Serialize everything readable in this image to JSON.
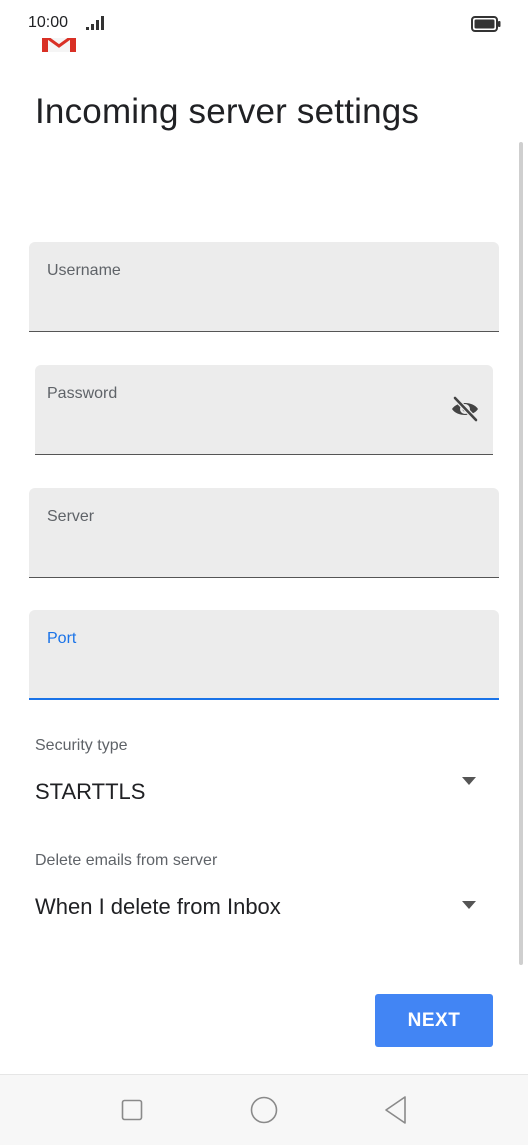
{
  "status_bar": {
    "time": "10:00",
    "signal_icon": "signal-bars-icon",
    "battery_icon": "battery-full-icon"
  },
  "app": {
    "logo_icon": "gmail-logo-icon"
  },
  "page": {
    "title": "Incoming server settings"
  },
  "fields": {
    "username": {
      "label": "Username",
      "value": ""
    },
    "password": {
      "label": "Password",
      "value": "",
      "toggle_icon": "visibility-off-icon"
    },
    "server": {
      "label": "Server",
      "value": ""
    },
    "port": {
      "label": "Port",
      "value": ""
    }
  },
  "security_type": {
    "label": "Security type",
    "value": "STARTTLS"
  },
  "delete_emails": {
    "label": "Delete emails from server",
    "value": "When I delete from Inbox"
  },
  "actions": {
    "next_label": "NEXT"
  },
  "nav_bar": {
    "recents_icon": "square-recents-icon",
    "home_icon": "circle-home-icon",
    "back_icon": "triangle-back-icon"
  },
  "colors": {
    "accent": "#1a73e8",
    "button": "#4285f4",
    "field_bg": "#ececec"
  }
}
